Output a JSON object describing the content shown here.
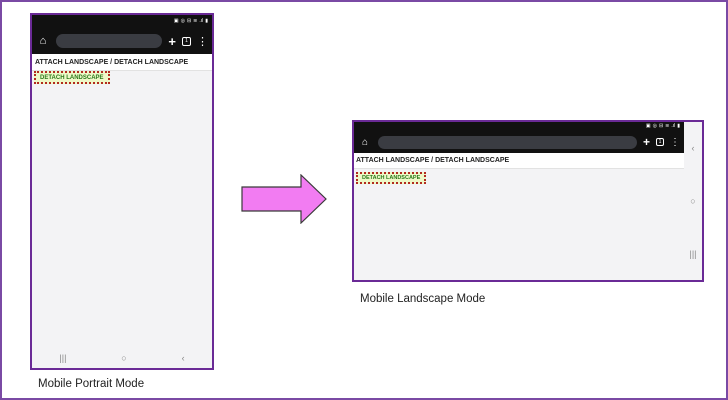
{
  "portrait": {
    "caption": "Mobile Portrait Mode",
    "status_icons": [
      "▣",
      "◎",
      "⊟",
      "≋",
      ".ıl",
      "▮"
    ],
    "toolbar": {
      "home_icon": "⌂",
      "new_tab_icon": "+",
      "tab_count": "1",
      "menu_icon": "⋮"
    },
    "page_heading": "ATTACH LANDSCAPE / DETACH LANDSCAPE",
    "button_label": "DETACH LANDSCAPE",
    "nav": {
      "recents_icon": "|||",
      "home_icon": "○",
      "back_icon": "‹"
    }
  },
  "landscape": {
    "caption": "Mobile Landscape Mode",
    "status_icons": [
      "▣",
      "◎",
      "⊟",
      "≋",
      ".ıl",
      "▮"
    ],
    "toolbar": {
      "home_icon": "⌂",
      "new_tab_icon": "+",
      "tab_count": "1",
      "menu_icon": "⋮"
    },
    "page_heading": "ATTACH LANDSCAPE / DETACH LANDSCAPE",
    "button_label": "DETACH LANDSCAPE",
    "nav": {
      "back_icon": "‹",
      "home_icon": "○",
      "recents_icon": "|||"
    }
  },
  "colors": {
    "frame_border": "#6a2a96",
    "arrow_fill": "#f27cf2",
    "button_bg": "#eef8c8",
    "button_border": "#b22a20",
    "button_text": "#2a7a1a",
    "browser_bar": "#111111"
  }
}
